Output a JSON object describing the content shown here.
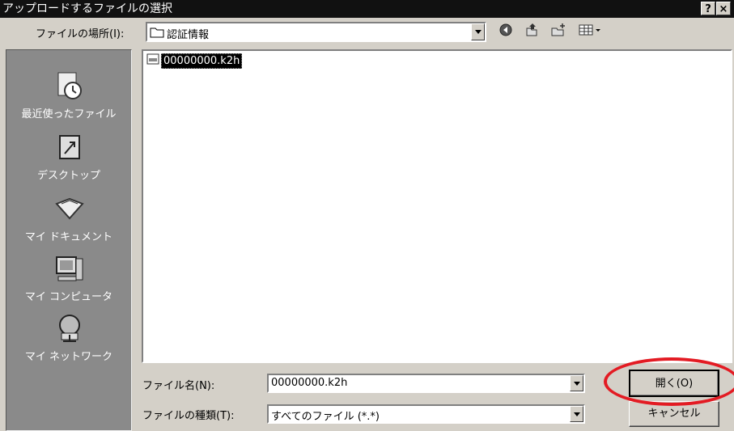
{
  "window": {
    "title": "アップロードするファイルの選択",
    "help_label": "?",
    "close_label": "×"
  },
  "lookin": {
    "label": "ファイルの場所(I):",
    "value": "認証情報"
  },
  "toolbar": {
    "icons": [
      "back-icon",
      "up-folder-icon",
      "new-folder-icon",
      "view-menu-icon"
    ]
  },
  "places": [
    {
      "label": "最近使ったファイル",
      "icon": "recent-files-icon"
    },
    {
      "label": "デスクトップ",
      "icon": "desktop-icon"
    },
    {
      "label": "マイ ドキュメント",
      "icon": "my-documents-icon"
    },
    {
      "label": "マイ コンピュータ",
      "icon": "my-computer-icon"
    },
    {
      "label": "マイ ネットワーク",
      "icon": "my-network-icon"
    }
  ],
  "files": [
    {
      "name": "00000000.k2h",
      "icon": "file-icon",
      "selected": true
    }
  ],
  "filename": {
    "label": "ファイル名(N):",
    "value": "00000000.k2h"
  },
  "filetype": {
    "label": "ファイルの種類(T):",
    "value": "すべてのファイル (*.*)"
  },
  "buttons": {
    "open": "開く(O)",
    "cancel": "キャンセル"
  },
  "colors": {
    "annotation": "#e31b23",
    "title_bar": "#111111",
    "dialog_bg": "#d4d0c8",
    "places_bar": "#8a8a8a"
  }
}
